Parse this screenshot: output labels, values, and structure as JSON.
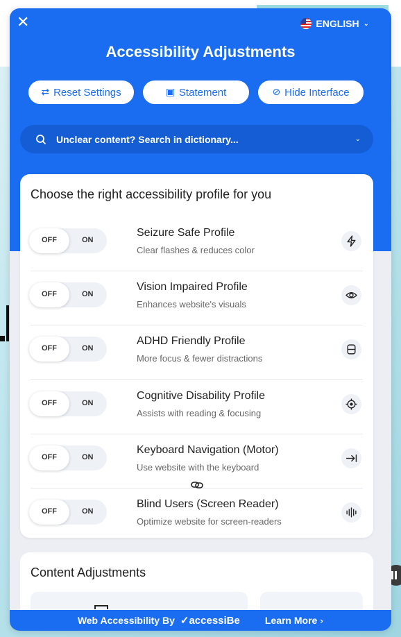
{
  "language": {
    "label": "ENGLISH"
  },
  "header": {
    "title": "Accessibility Adjustments"
  },
  "buttons": {
    "reset": "Reset Settings",
    "statement": "Statement",
    "hide": "Hide Interface"
  },
  "search": {
    "placeholder": "Unclear content? Search in dictionary..."
  },
  "profiles": {
    "title": "Choose the right accessibility profile for you",
    "toggle_off": "OFF",
    "toggle_on": "ON",
    "items": [
      {
        "name": "Seizure Safe Profile",
        "desc": "Clear flashes & reduces color",
        "icon": "lightning-icon",
        "state": "OFF"
      },
      {
        "name": "Vision Impaired Profile",
        "desc": "Enhances website's visuals",
        "icon": "eye-icon",
        "state": "OFF"
      },
      {
        "name": "ADHD Friendly Profile",
        "desc": "More focus & fewer distractions",
        "icon": "focus-box-icon",
        "state": "OFF"
      },
      {
        "name": "Cognitive Disability Profile",
        "desc": "Assists with reading & focusing",
        "icon": "target-icon",
        "state": "OFF"
      },
      {
        "name": "Keyboard Navigation (Motor)",
        "desc": "Use website with the keyboard",
        "icon": "arrow-tab-icon",
        "state": "OFF"
      },
      {
        "name": "Blind Users (Screen Reader)",
        "desc": "Optimize website for screen-readers",
        "icon": "soundwave-icon",
        "state": "OFF"
      }
    ]
  },
  "content": {
    "title": "Content Adjustments"
  },
  "footer": {
    "prefix": "Web Accessibility By",
    "brand": "accessiBe",
    "learn": "Learn More"
  },
  "colors": {
    "primary": "#1a6df0",
    "panel_bg": "#eceef4"
  }
}
